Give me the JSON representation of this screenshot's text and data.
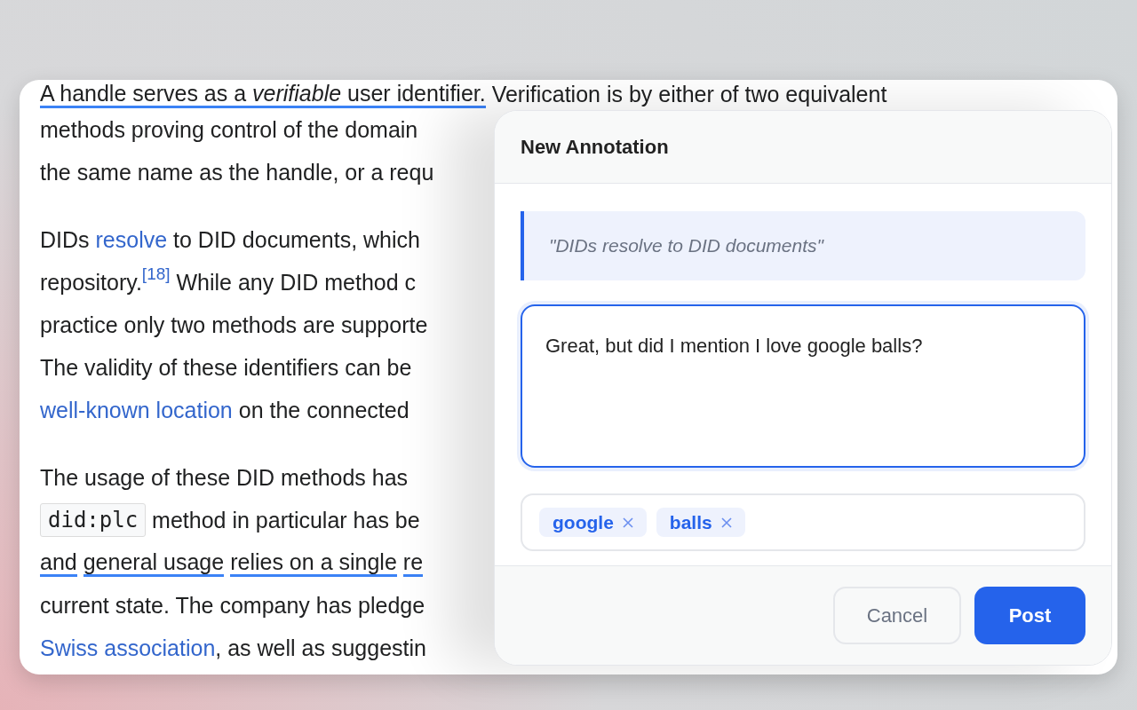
{
  "article": {
    "paragraphs": [
      {
        "lines": [
          [
            {
              "kind": "underlined",
              "text": "A handle serves as a *verifiable* user identifier."
            },
            {
              "kind": "text",
              "text": " Verification is by either of two equivalent"
            }
          ],
          [
            {
              "kind": "text",
              "text": "methods proving control of the domain"
            }
          ],
          [
            {
              "kind": "text",
              "text": "the same name as the handle, or a requ"
            }
          ]
        ]
      },
      {
        "lines": [
          [
            {
              "kind": "text",
              "text": "DIDs "
            },
            {
              "kind": "link",
              "text": "resolve"
            },
            {
              "kind": "text",
              "text": " to DID documents, which"
            }
          ],
          [
            {
              "kind": "text",
              "text": "repository."
            },
            {
              "kind": "footnote",
              "text": "[18]"
            },
            {
              "kind": "text",
              "text": " While any DID method c"
            }
          ],
          [
            {
              "kind": "text",
              "text": "practice only two methods are supporte"
            }
          ],
          [
            {
              "kind": "text",
              "text": "The validity of these identifiers can be"
            }
          ],
          [
            {
              "kind": "link",
              "text": "well-known location"
            },
            {
              "kind": "text",
              "text": " on the connected"
            }
          ]
        ]
      },
      {
        "lines": [
          [
            {
              "kind": "text",
              "text": "The usage of these DID methods has"
            }
          ],
          [
            {
              "kind": "code",
              "text": "did:plc"
            },
            {
              "kind": "text",
              "text": " method in particular has be"
            }
          ],
          [
            {
              "kind": "underlined",
              "text": "and"
            },
            {
              "kind": "underlined",
              "text": "general usage"
            },
            {
              "kind": "underlined",
              "text": "relies on a single"
            },
            {
              "kind": "underlined",
              "text": "re"
            }
          ],
          [
            {
              "kind": "text",
              "text": "current state. The company has pledge"
            }
          ],
          [
            {
              "kind": "link",
              "text": "Swiss association"
            },
            {
              "kind": "text",
              "text": ", as well as suggestin"
            }
          ]
        ]
      }
    ]
  },
  "dialog": {
    "title": "New Annotation",
    "quote": "\"DIDs resolve to DID documents\"",
    "comment": "Great, but did I mention I love google balls?",
    "tags": [
      {
        "label": "google"
      },
      {
        "label": "balls"
      }
    ],
    "buttons": [
      {
        "label": "Cancel",
        "kind": "secondary"
      },
      {
        "label": "Post",
        "kind": "primary"
      }
    ]
  }
}
